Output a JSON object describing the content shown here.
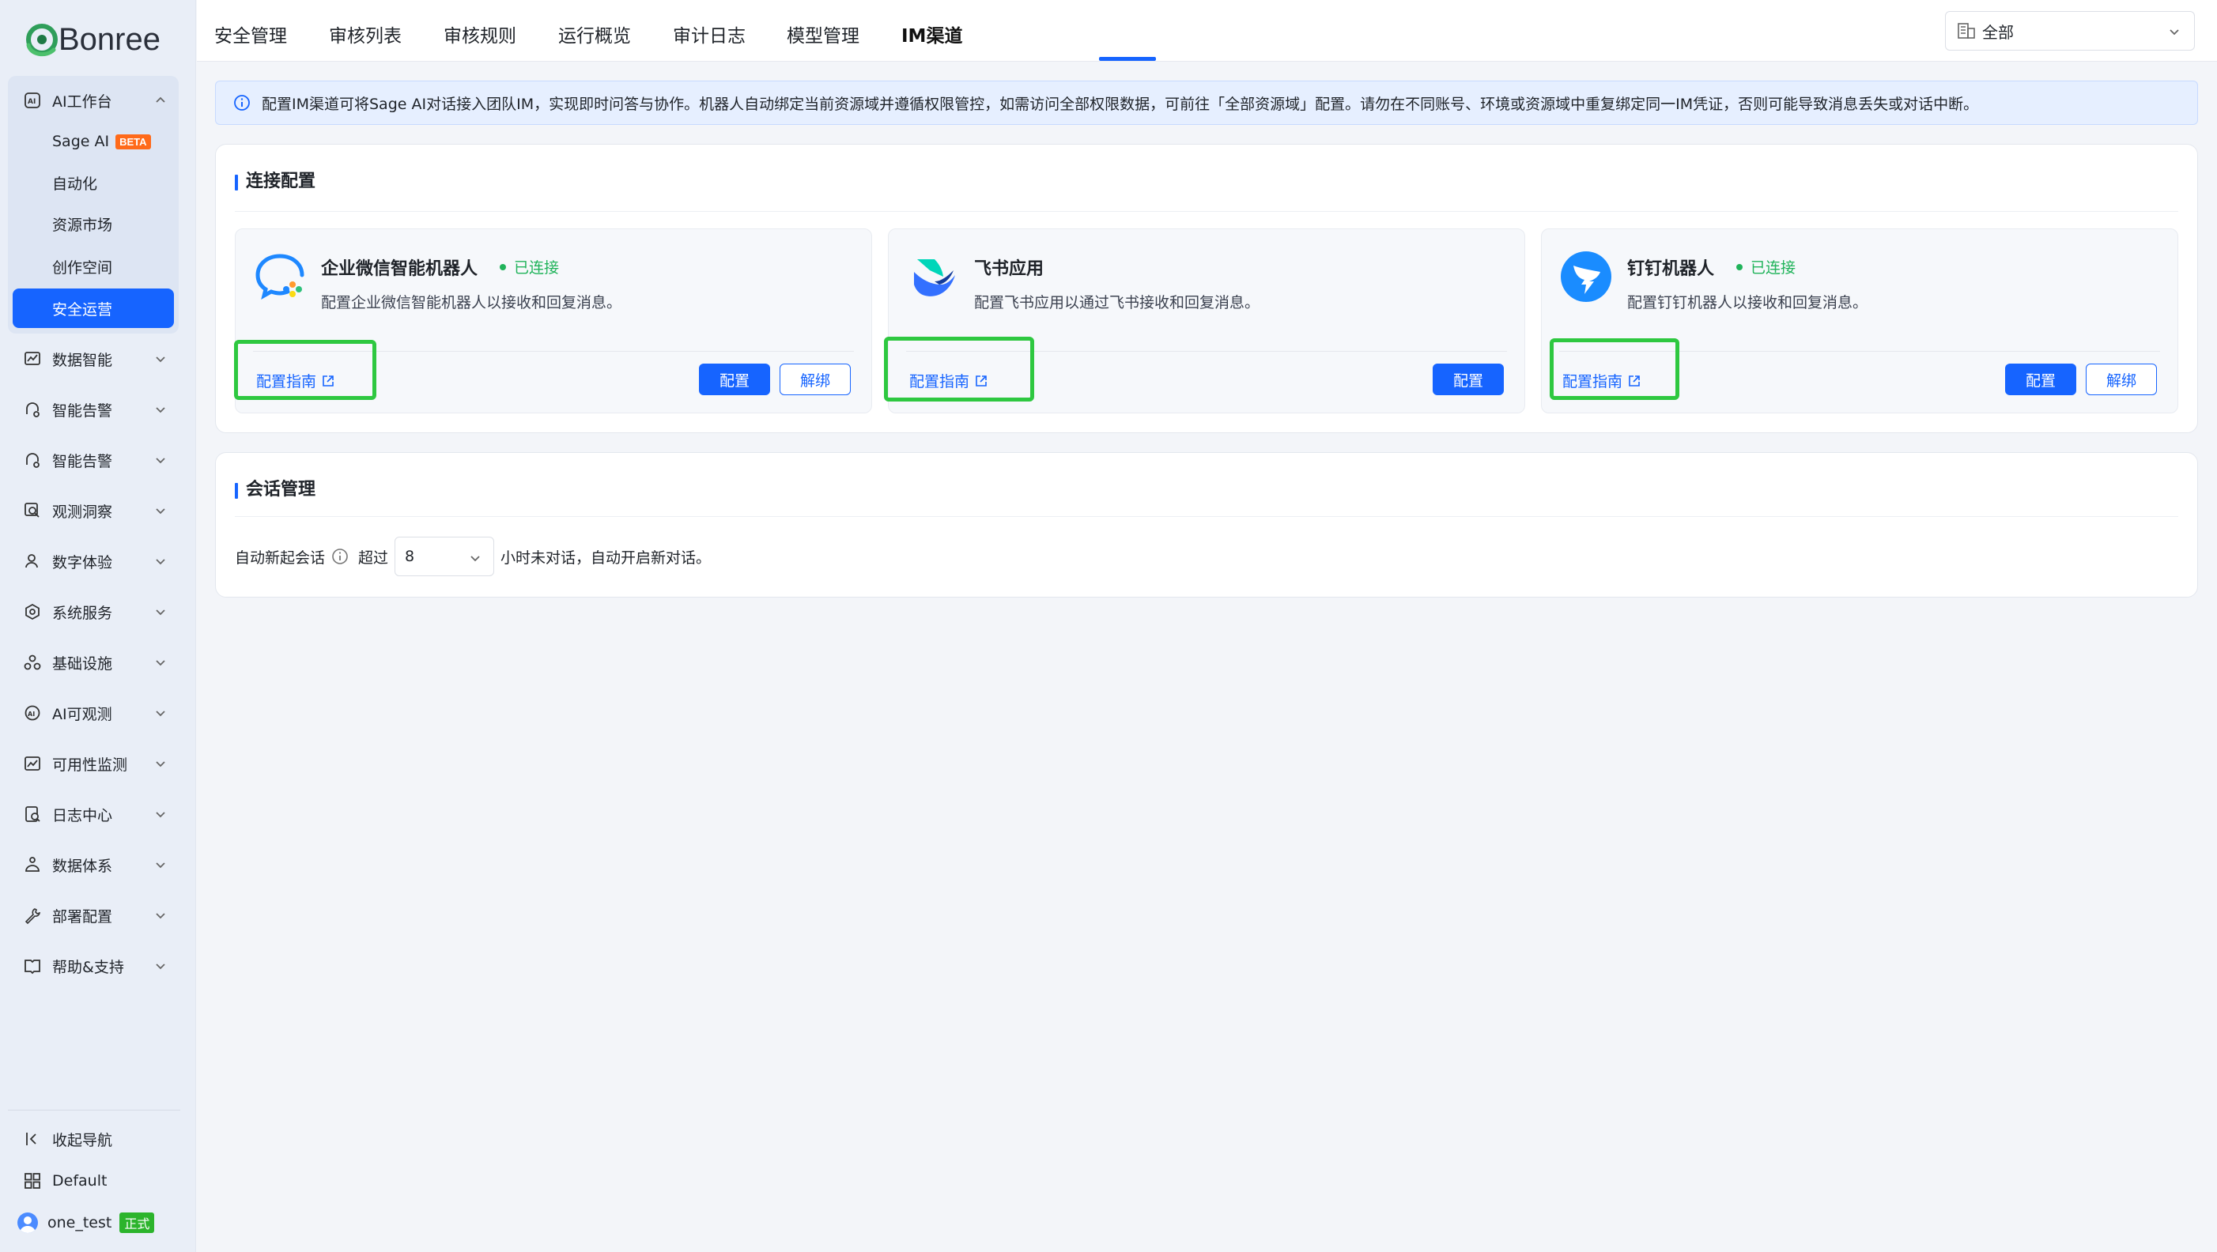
{
  "brand": {
    "name": "Bonree"
  },
  "sidebar": {
    "group_open": {
      "label": "AI工作台",
      "icon": "ai-workbench-icon"
    },
    "sub_items": [
      {
        "label": "Sage AI",
        "badge": "BETA"
      },
      {
        "label": "自动化"
      },
      {
        "label": "资源市场"
      },
      {
        "label": "创作空间"
      },
      {
        "label": "安全运营",
        "active": true
      }
    ],
    "items": [
      {
        "label": "数据智能",
        "icon": "chart-icon"
      },
      {
        "label": "智能告警",
        "icon": "alarm-icon"
      },
      {
        "label": "智能告警",
        "icon": "alarm-icon"
      },
      {
        "label": "观测洞察",
        "icon": "insight-icon"
      },
      {
        "label": "数字体验",
        "icon": "user-experience-icon"
      },
      {
        "label": "系统服务",
        "icon": "system-service-icon"
      },
      {
        "label": "基础设施",
        "icon": "infrastructure-icon"
      },
      {
        "label": "AI可观测",
        "icon": "ai-observe-icon"
      },
      {
        "label": "可用性监测",
        "icon": "availability-icon"
      },
      {
        "label": "日志中心",
        "icon": "log-icon"
      },
      {
        "label": "数据体系",
        "icon": "data-system-icon"
      },
      {
        "label": "部署配置",
        "icon": "wrench-icon"
      },
      {
        "label": "帮助&支持",
        "icon": "book-icon"
      }
    ],
    "footer": {
      "collapse_label": "收起导航",
      "workspace_label": "Default",
      "user_name": "one_test",
      "user_badge": "正式"
    }
  },
  "topbar": {
    "tabs": [
      {
        "label": "安全管理"
      },
      {
        "label": "审核列表"
      },
      {
        "label": "审核规则"
      },
      {
        "label": "运行概览"
      },
      {
        "label": "审计日志"
      },
      {
        "label": "模型管理"
      },
      {
        "label": "IM渠道",
        "active": true
      }
    ],
    "scope": {
      "value": "全部"
    }
  },
  "banner": {
    "text": "配置IM渠道可将Sage AI对话接入团队IM，实现即时问答与协作。机器人自动绑定当前资源域并遵循权限管控，如需访问全部权限数据，可前往「全部资源域」配置。请勿在不同账号、环境或资源域中重复绑定同一IM凭证，否则可能导致消息丢失或对话中断。"
  },
  "connection": {
    "title": "连接配置",
    "cards": [
      {
        "name": "企业微信智能机器人",
        "status": "已连接",
        "description": "配置企业微信智能机器人以接收和回复消息。",
        "guide_label": "配置指南",
        "config_label": "配置",
        "unbind_label": "解绑",
        "brand_color": "#1e88ff"
      },
      {
        "name": "飞书应用",
        "status": "",
        "description": "配置飞书应用以通过飞书接收和回复消息。",
        "guide_label": "配置指南",
        "config_label": "配置",
        "unbind_label": "",
        "brand_color": "#1d3fc4"
      },
      {
        "name": "钉钉机器人",
        "status": "已连接",
        "description": "配置钉钉机器人以接收和回复消息。",
        "guide_label": "配置指南",
        "config_label": "配置",
        "unbind_label": "解绑",
        "brand_color": "#1a8cff"
      }
    ]
  },
  "session": {
    "title": "会话管理",
    "label": "自动新起会话",
    "prefix": "超过",
    "hours_value": "8",
    "suffix": "小时未对话，自动开启新对话。"
  },
  "colors": {
    "primary": "#1664ff",
    "success": "#20b35a",
    "highlight": "#2ec840",
    "beta": "#ff6a1a",
    "env_badge": "#2cb42c"
  }
}
